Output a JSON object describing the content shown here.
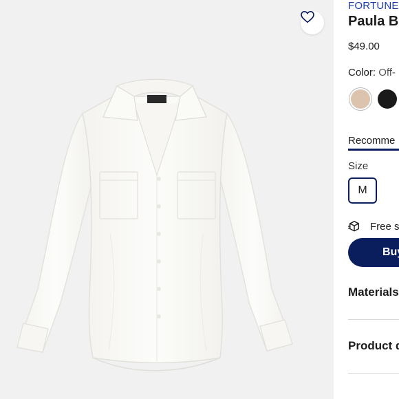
{
  "product": {
    "brand": "FORTUNE",
    "title": "Paula Bu",
    "price": "$49.00",
    "image_alt": "White button-down blouse with chest pockets"
  },
  "color": {
    "label": "Color:",
    "value": "Off-",
    "swatches": [
      {
        "name": "off-white",
        "hex": "#dcc3ad",
        "selected": true
      },
      {
        "name": "black",
        "hex": "#1a1a1a",
        "selected": false
      }
    ]
  },
  "tabs": {
    "recommended": "Recomme"
  },
  "size": {
    "label": "Size",
    "selected": "M"
  },
  "shipping": {
    "text": "Free s"
  },
  "buy": {
    "label": "Buy"
  },
  "accordion": {
    "materials": "Materials",
    "product_details": "Product d"
  },
  "colors": {
    "brand_blue": "#1a3aa8",
    "navy": "#0a1e5e",
    "image_bg": "#f1f1f1"
  }
}
